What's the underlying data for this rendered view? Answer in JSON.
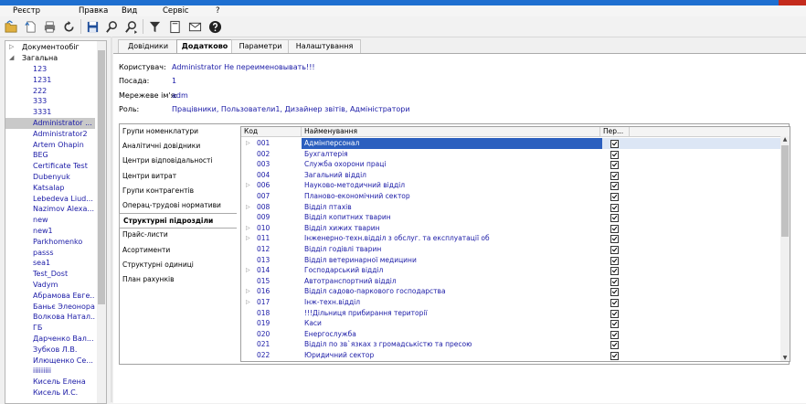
{
  "menu": [
    "Реєстр",
    "Правка",
    "Вид",
    "Сервіс",
    "?"
  ],
  "toolbar": [
    "folder-open-icon",
    "new-doc-icon",
    "print-icon",
    "refresh-icon",
    "save-icon",
    "find-icon",
    "find-next-icon",
    "filter-icon",
    "page-icon",
    "mail-icon",
    "help-icon"
  ],
  "tree": {
    "root1": "Документообіг",
    "root2": "Загальна",
    "children": [
      "123",
      "1231",
      "222",
      "333",
      "3331",
      "Administrator ...",
      "Administrator2",
      "Artem Ohapin",
      "BEG",
      "Certificate Test",
      "Dubenyuk",
      "Katsalap",
      "Lebedeva Liud...",
      "Nazimov Alexa...",
      "new",
      "new1",
      "Parkhomenko",
      "passs",
      "sea1",
      "Test_Dost",
      "Vadym",
      "Абрамова Евге...",
      "Баньє Элеонора",
      "Волкова Натал...",
      "ГБ",
      "Дарченко Вал...",
      "Зубков Л.В.",
      "Илющенко Се...",
      "iiiiiiiii",
      "Кисель Елена",
      "Кисель И.С."
    ],
    "selected_index": 5
  },
  "tabs": [
    "Довідники",
    "Додатково",
    "Параметри",
    "Налаштування"
  ],
  "active_tab": 1,
  "fields": {
    "user_label": "Користувач:",
    "user_value": "Administrator Не переименовывать!!!",
    "position_label": "Посада:",
    "position_value": "1",
    "network_label": "Мережеве ім'я:",
    "network_value": "adm",
    "role_label": "Роль:",
    "role_value": "Працівники, Пользователи1, Дизайнер звітів, Адміністратори"
  },
  "categories": [
    "Групи номенклатури",
    "Аналітичні довідники",
    "Центри відповідальності",
    "Центри витрат",
    "Групи контрагентів",
    "Операц-трудові нормативи",
    "Структурні підрозділи",
    "Прайс-листи",
    "Асортименти",
    "Структурні одиниці",
    "План рахунків"
  ],
  "active_category": 6,
  "grid": {
    "headers": [
      "Код",
      "Найменування",
      "Пер..."
    ],
    "rows": [
      {
        "code": "001",
        "name": "Адмінперсонал",
        "exp": true
      },
      {
        "code": "002",
        "name": "Бухгалтерія",
        "exp": false
      },
      {
        "code": "003",
        "name": "Служба охорони праці",
        "exp": false
      },
      {
        "code": "004",
        "name": "Загальний відділ",
        "exp": false
      },
      {
        "code": "006",
        "name": "Науково-методичний відділ",
        "exp": true
      },
      {
        "code": "007",
        "name": "Планово-економічний сектор",
        "exp": false
      },
      {
        "code": "008",
        "name": "Відділ птахів",
        "exp": true
      },
      {
        "code": "009",
        "name": "Відділ копитних тварин",
        "exp": false
      },
      {
        "code": "010",
        "name": "Відділ хижих тварин",
        "exp": true
      },
      {
        "code": "011",
        "name": "Інженерно-техн.відділ з обслуг. та експлуатації об",
        "exp": true
      },
      {
        "code": "012",
        "name": "Відділ годівлі тварин",
        "exp": false
      },
      {
        "code": "013",
        "name": "Відділ ветеринарної медицини",
        "exp": false
      },
      {
        "code": "014",
        "name": "Господарський відділ",
        "exp": true
      },
      {
        "code": "015",
        "name": "Автотранспортний відділ",
        "exp": false
      },
      {
        "code": "016",
        "name": "Відділ садово-паркового господарства",
        "exp": true
      },
      {
        "code": "017",
        "name": "Інж-техн.відділ",
        "exp": true
      },
      {
        "code": "018",
        "name": "!!!Дільниця прибирання території",
        "exp": false
      },
      {
        "code": "019",
        "name": "Каси",
        "exp": false
      },
      {
        "code": "020",
        "name": "Енергослужба",
        "exp": false
      },
      {
        "code": "021",
        "name": "Відділ по зв`язках з громадськістю та пресою",
        "exp": false
      },
      {
        "code": "022",
        "name": "Юридичний сектор",
        "exp": false
      }
    ],
    "selected_index": 0
  }
}
